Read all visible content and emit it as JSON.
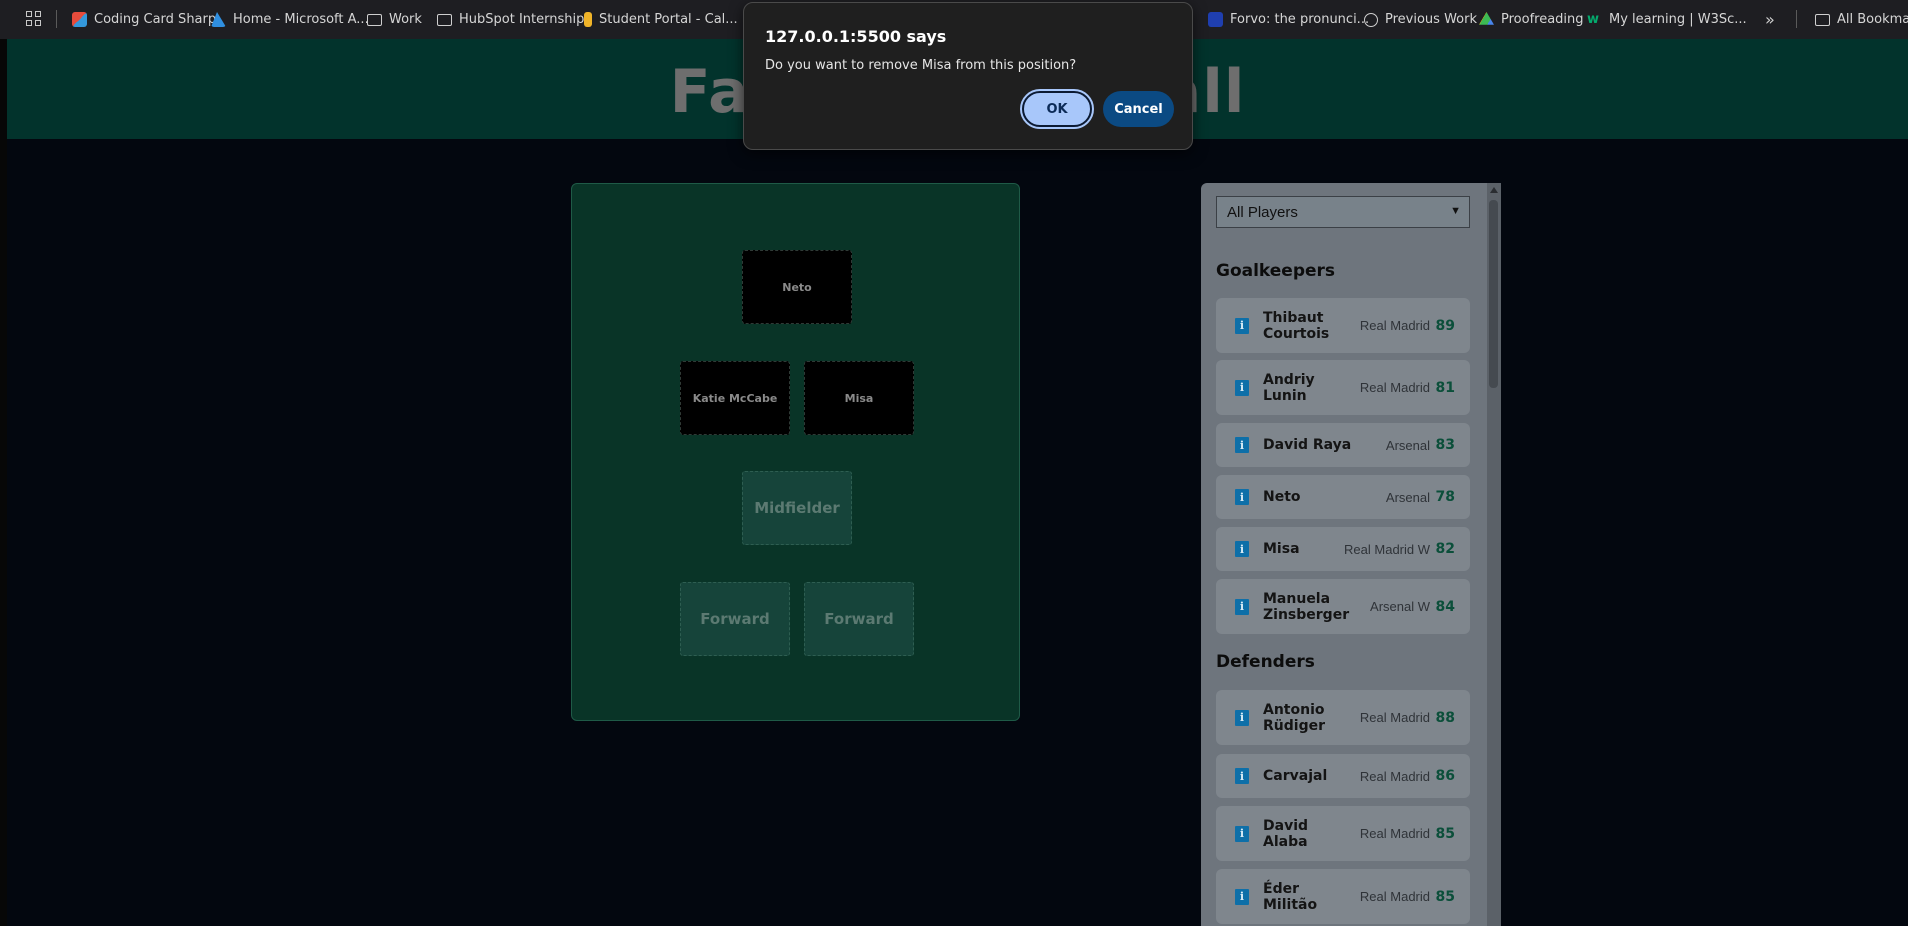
{
  "bookmarks": {
    "items": [
      {
        "label": "Coding Card Sharp",
        "icon": "colored-tile-icon"
      },
      {
        "label": "Home - Microsoft A...",
        "icon": "azure-icon"
      },
      {
        "label": "Work",
        "icon": "folder-icon"
      },
      {
        "label": "HubSpot Internship",
        "icon": "folder-icon"
      },
      {
        "label": "Student Portal - Cal...",
        "icon": "portal-icon"
      },
      {
        "label": "Forvo: the pronunci...",
        "icon": "forvo-icon"
      },
      {
        "label": "Previous Work",
        "icon": "globe-icon"
      },
      {
        "label": "Proofreading",
        "icon": "drive-icon"
      },
      {
        "label": "My learning | W3Sc...",
        "icon": "w3schools-icon"
      },
      {
        "label": "All Bookmarks",
        "icon": "folder-icon"
      }
    ]
  },
  "page": {
    "title": "Fantasy Football"
  },
  "pitch": {
    "slots": [
      {
        "label": "Neto",
        "state": "filled"
      },
      {
        "label": "Katie McCabe",
        "state": "filled"
      },
      {
        "label": "Misa",
        "state": "filled"
      },
      {
        "label": "Midfielder",
        "state": "empty"
      },
      {
        "label": "Forward",
        "state": "empty"
      },
      {
        "label": "Forward",
        "state": "empty"
      }
    ]
  },
  "sidebar": {
    "filter_value": "All Players",
    "goalkeepers_title": "Goalkeepers",
    "defenders_title": "Defenders",
    "goalkeepers": [
      {
        "name": "Thibaut Courtois",
        "club": "Real Madrid",
        "rating": "89"
      },
      {
        "name": "Andriy Lunin",
        "club": "Real Madrid",
        "rating": "81"
      },
      {
        "name": "David Raya",
        "club": "Arsenal",
        "rating": "83"
      },
      {
        "name": "Neto",
        "club": "Arsenal",
        "rating": "78"
      },
      {
        "name": "Misa",
        "club": "Real Madrid W",
        "rating": "82"
      },
      {
        "name": "Manuela Zinsberger",
        "club": "Arsenal W",
        "rating": "84"
      }
    ],
    "defenders": [
      {
        "name": "Antonio Rüdiger",
        "club": "Real Madrid",
        "rating": "88"
      },
      {
        "name": "Carvajal",
        "club": "Real Madrid",
        "rating": "86"
      },
      {
        "name": "David Alaba",
        "club": "Real Madrid",
        "rating": "85"
      },
      {
        "name": "Éder Militão",
        "club": "Real Madrid",
        "rating": "85"
      }
    ]
  },
  "dialog": {
    "title": "127.0.0.1:5500 says",
    "message": "Do you want to remove Misa from this position?",
    "ok_label": "OK",
    "cancel_label": "Cancel"
  }
}
